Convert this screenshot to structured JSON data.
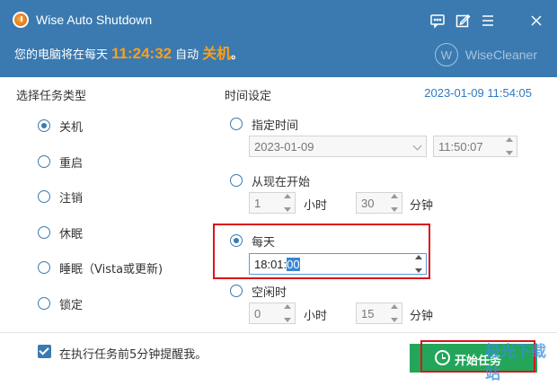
{
  "window": {
    "title": "Wise Auto Shutdown"
  },
  "banner": {
    "prefix": "您的电脑将在每天",
    "time": "11:24:32",
    "middle": "自动",
    "action": "关机",
    "suffix": "。"
  },
  "brand": {
    "mark": "W",
    "name": "WiseCleaner"
  },
  "task_type": {
    "title": "选择任务类型",
    "options": [
      {
        "label": "关机",
        "checked": true
      },
      {
        "label": "重启",
        "checked": false
      },
      {
        "label": "注销",
        "checked": false
      },
      {
        "label": "休眠",
        "checked": false
      },
      {
        "label": "睡眠（Vista或更新)",
        "checked": false
      },
      {
        "label": "锁定",
        "checked": false
      }
    ]
  },
  "time_settings": {
    "title": "时间设定",
    "current_datetime": "2023-01-09 11:54:05",
    "specified": {
      "label": "指定时间",
      "date": "2023-01-09",
      "time": "11:50:07"
    },
    "from_now": {
      "label": "从现在开始",
      "hours": "1",
      "hours_unit": "小时",
      "minutes": "30",
      "minutes_unit": "分钟"
    },
    "daily": {
      "label": "每天",
      "time_prefix": "18:01:",
      "time_selected": "00"
    },
    "idle": {
      "label": "空闲时",
      "hours": "0",
      "hours_unit": "小时",
      "minutes": "15",
      "minutes_unit": "分钟"
    }
  },
  "footer": {
    "remind_label": "在执行任务前5分钟提醒我。",
    "start_label": "开始任务",
    "watermark": "极光下载站"
  }
}
